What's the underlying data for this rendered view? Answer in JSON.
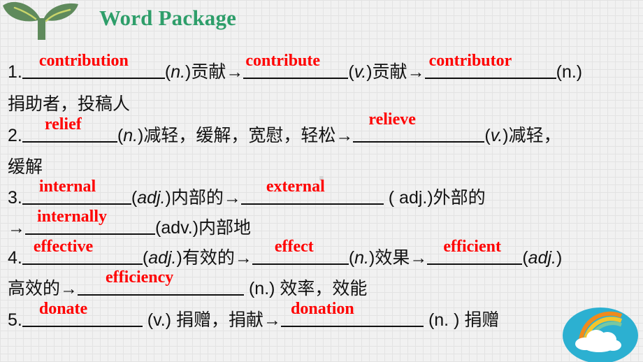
{
  "header": {
    "title": "Word Package",
    "logo_icon": "sprout-icon",
    "title_color": "#2e9e6a"
  },
  "answer_color": "#ff0000",
  "items": {
    "1": {
      "num": "1.",
      "a1": "contribution",
      "t1": "(",
      "p1": "n.",
      "t1b": ")贡献→",
      "a2": "contribute",
      "t2": "(",
      "p2": "v.",
      "t2b": ")贡献→",
      "a3": "contributor",
      "t3": "(n.)",
      "cont": "捐助者，投稿人"
    },
    "2": {
      "num": "2.",
      "a1": "relief",
      "t1": "(",
      "p1": "n.",
      "t1b": ")减轻，缓解，宽慰，轻松→",
      "a2": "relieve",
      "t2": "(",
      "p2": "v.",
      "t2b": ")减轻，",
      "cont": "缓解"
    },
    "3": {
      "num": "3.",
      "a1": "internal",
      "t1": "(",
      "p1": "adj.",
      "t1b": ")内部的→",
      "a2": "external",
      "t2": " ( adj.)外部的",
      "arrow": "→",
      "a3": "internally",
      "t3": "(adv.)内部地"
    },
    "4": {
      "num": "4.",
      "a1": "effective",
      "t1": "(",
      "p1": "adj.",
      "t1b": ")有效的→",
      "a2": "effect",
      "t2": "(",
      "p2": "n.",
      "t2b": ")效果→",
      "a3": "efficient",
      "t3": "(",
      "p3": "adj.",
      "t3b": ")",
      "cont": "高效的→",
      "a4": "efficiency",
      "t4": " (n.) 效率，效能"
    },
    "5": {
      "num": "5.",
      "a1": "donate",
      "t1": " (v.) 捐赠，捐献→",
      "a2": "donation",
      "t2": " (n. ) 捐赠"
    }
  },
  "decorations": {
    "bottom_right_icon": "rainbow-cloud-icon"
  }
}
